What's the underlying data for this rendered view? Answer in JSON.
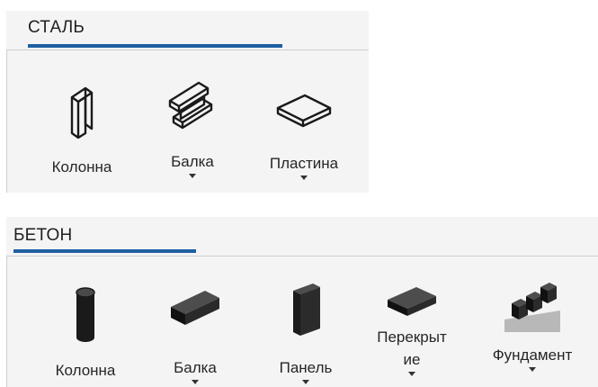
{
  "steel": {
    "tab": "СТАЛЬ",
    "tools": [
      {
        "label": "Колонна",
        "icon": "steel-column-icon",
        "dropdown": false
      },
      {
        "label": "Балка",
        "icon": "steel-beam-icon",
        "dropdown": true
      },
      {
        "label": "Пластина",
        "icon": "steel-plate-icon",
        "dropdown": true
      }
    ]
  },
  "concrete": {
    "tab": "БЕТОН",
    "tools": [
      {
        "label": "Колонна",
        "icon": "concrete-column-icon",
        "dropdown": false
      },
      {
        "label": "Балка",
        "icon": "concrete-beam-icon",
        "dropdown": true
      },
      {
        "label": "Панель",
        "icon": "concrete-panel-icon",
        "dropdown": true
      },
      {
        "label_line1": "Перекрыт",
        "label_line2": "ие",
        "icon": "concrete-slab-icon",
        "dropdown": true
      },
      {
        "label": "Фундамент",
        "icon": "concrete-footing-icon",
        "dropdown": true
      }
    ]
  },
  "colors": {
    "accent": "#1f5fa3",
    "ribbon_bg": "#f4f4f4",
    "icon": "#1a1a1a"
  }
}
